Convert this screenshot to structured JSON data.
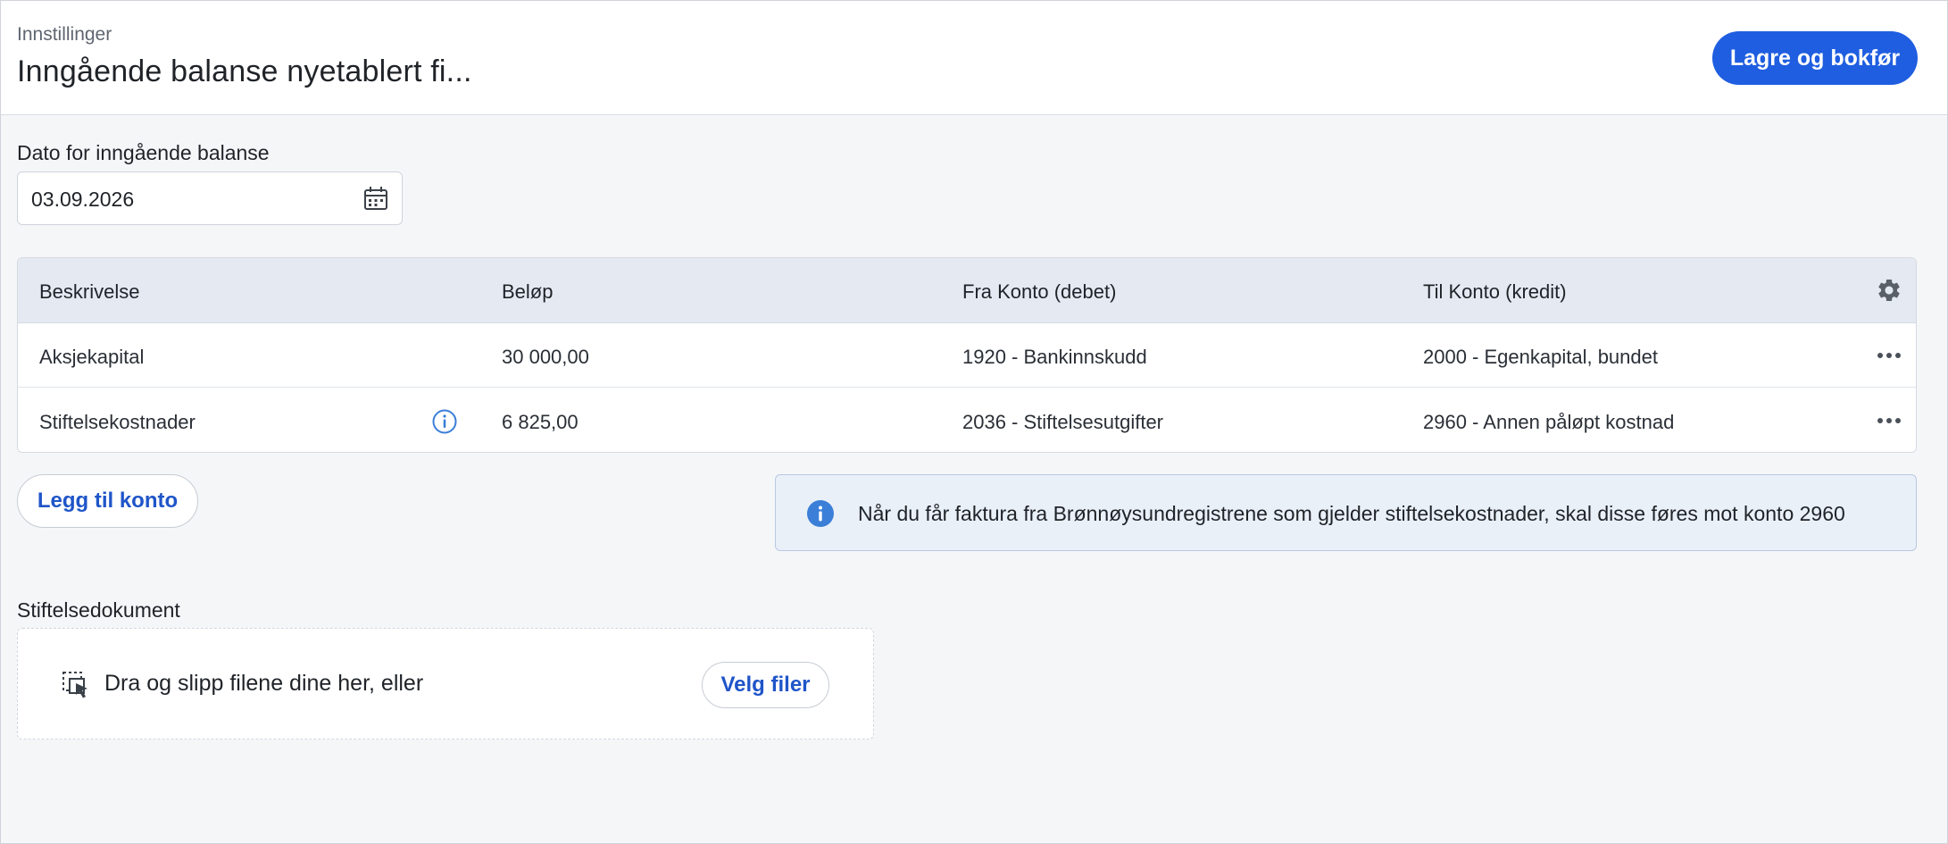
{
  "header": {
    "breadcrumb": "Innstillinger",
    "title": "Inngående balanse nyetablert fi...",
    "save_label": "Lagre og bokfør"
  },
  "date": {
    "label": "Dato for inngående balanse",
    "value": "03.09.2026",
    "icon": "calendar-icon"
  },
  "table": {
    "columns": [
      "Beskrivelse",
      "Beløp",
      "Fra Konto (debet)",
      "Til Konto (kredit)"
    ],
    "settings_icon": "gear-icon",
    "rows": [
      {
        "description": "Aksjekapital",
        "amount": "30 000,00",
        "from_account": "1920 - Bankinnskudd",
        "to_account": "2000 - Egenkapital, bundet",
        "info_icon": false
      },
      {
        "description": "Stiftelsekostnader",
        "amount": "6 825,00",
        "from_account": "2036 - Stiftelsesutgifter",
        "to_account": "2960 - Annen påløpt kostnad",
        "info_icon": true
      }
    ]
  },
  "add_account_label": "Legg til konto",
  "info_banner": {
    "text": "Når du får faktura fra Brønnøysundregistrene som gjelder stiftelsekostnader, skal disse føres mot konto 2960",
    "icon": "info-icon"
  },
  "upload": {
    "label": "Stiftelsedokument",
    "drop_text": "Dra og slipp filene dine her, eller",
    "choose_label": "Velg filer"
  },
  "colors": {
    "accent": "#1f5ee0",
    "link": "#1f55c8",
    "table_header_bg": "#e5eaf2",
    "info_bg": "#eaf0f8",
    "info_icon": "#3b7fd8"
  }
}
